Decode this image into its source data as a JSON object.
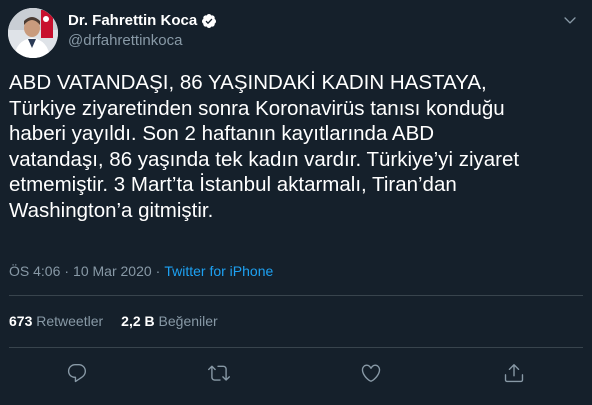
{
  "author": {
    "display_name": "Dr. Fahrettin Koca",
    "handle": "@drfahrettinkoca",
    "verified": true
  },
  "tweet": {
    "lines": [
      "ABD VATANDAŞI, 86 YAŞINDAKİ KADIN HASTAYA,",
      "Türkiye ziyaretinden sonra Koronavirüs tanısı konduğu",
      "haberi yayıldı. Son 2 haftanın kayıtlarında ABD",
      "vatandaşı, 86 yaşında tek kadın vardır. Türkiye’yi ziyaret",
      "etmemiştir. 3 Mart’ta İstanbul aktarmalı, Tiran’dan",
      "Washington’a gitmiştir."
    ]
  },
  "meta": {
    "time": "ÖS 4:06",
    "separator1": "·",
    "date": "10 Mar 2020",
    "separator2": "·",
    "source": "Twitter for iPhone"
  },
  "stats": {
    "retweets_count": "673",
    "retweets_label": "Retweetler",
    "likes_count": "2,2 B",
    "likes_label": "Beğeniler"
  },
  "icons": {
    "more": "chevron-down-icon",
    "reply": "reply-icon",
    "retweet": "retweet-icon",
    "like": "heart-icon",
    "share": "share-icon"
  },
  "colors": {
    "background": "#15202b",
    "secondary_text": "#8899a6",
    "accent": "#1da1f2",
    "divider": "#38444d"
  }
}
